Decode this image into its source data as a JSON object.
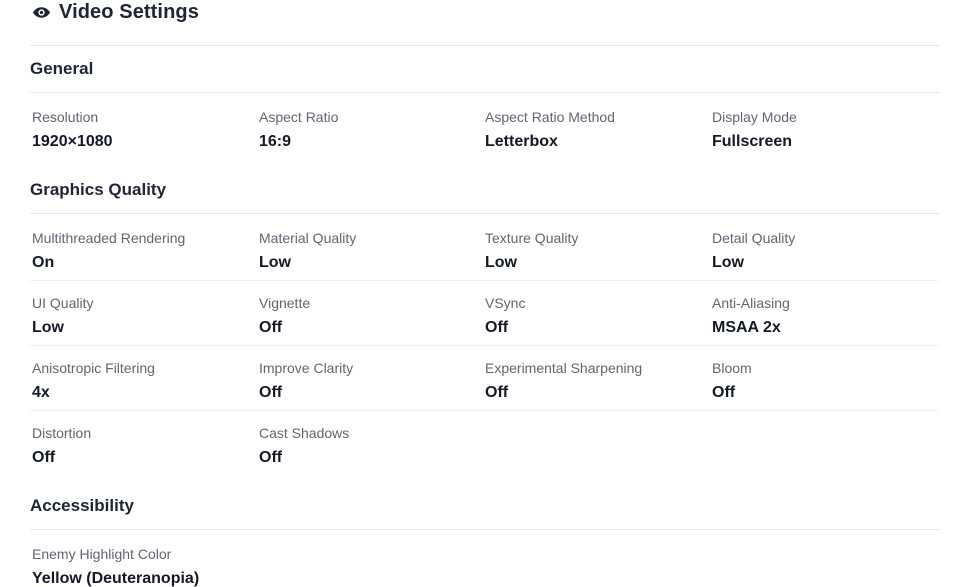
{
  "title": "Video Settings",
  "sections": {
    "general": {
      "heading": "General",
      "items": [
        {
          "label": "Resolution",
          "value": "1920×1080"
        },
        {
          "label": "Aspect Ratio",
          "value": "16:9"
        },
        {
          "label": "Aspect Ratio Method",
          "value": "Letterbox"
        },
        {
          "label": "Display Mode",
          "value": "Fullscreen"
        }
      ]
    },
    "graphics": {
      "heading": "Graphics Quality",
      "items": [
        {
          "label": "Multithreaded Rendering",
          "value": "On"
        },
        {
          "label": "Material Quality",
          "value": "Low"
        },
        {
          "label": "Texture Quality",
          "value": "Low"
        },
        {
          "label": "Detail Quality",
          "value": "Low"
        },
        {
          "label": "UI Quality",
          "value": "Low"
        },
        {
          "label": "Vignette",
          "value": "Off"
        },
        {
          "label": "VSync",
          "value": "Off"
        },
        {
          "label": "Anti-Aliasing",
          "value": "MSAA 2x"
        },
        {
          "label": "Anisotropic Filtering",
          "value": "4x"
        },
        {
          "label": "Improve Clarity",
          "value": "Off"
        },
        {
          "label": "Experimental Sharpening",
          "value": "Off"
        },
        {
          "label": "Bloom",
          "value": "Off"
        },
        {
          "label": "Distortion",
          "value": "Off"
        },
        {
          "label": "Cast Shadows",
          "value": "Off"
        }
      ]
    },
    "accessibility": {
      "heading": "Accessibility",
      "items": [
        {
          "label": "Enemy Highlight Color",
          "value": "Yellow (Deuteranopia)"
        }
      ]
    }
  },
  "icons": {
    "title_icon": "eye-icon"
  }
}
